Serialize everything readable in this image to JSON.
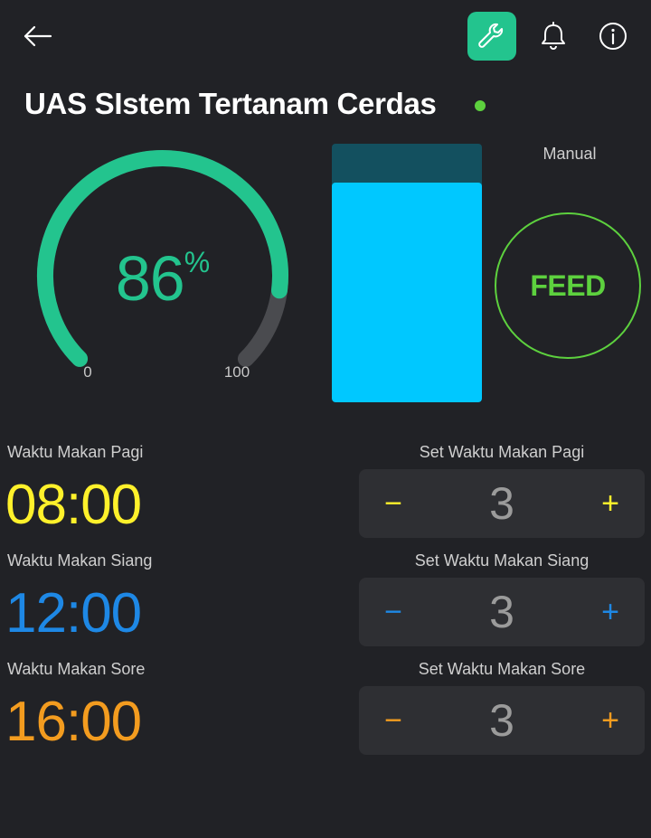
{
  "header": {
    "back_icon": "arrow-left-icon",
    "tool_icon": "wrench-icon",
    "bell_icon": "bell-icon",
    "info_icon": "info-icon",
    "accent": "#23c48e"
  },
  "title": "UAS SIstem Tertanam Cerdas",
  "status_color": "#5dd13e",
  "gauge": {
    "value": "86",
    "unit": "%",
    "min": "0",
    "max": "100",
    "fraction": 0.86,
    "color": "#23c48e",
    "track_color": "#4a4b4f"
  },
  "level": {
    "fraction": 0.85,
    "fill_color": "#00c8ff"
  },
  "manual": {
    "label": "Manual",
    "feed_label": "FEED"
  },
  "schedule": [
    {
      "label": "Waktu Makan Pagi",
      "time": "08:00",
      "color": "#fff12b",
      "set_label": "Set Waktu Makan Pagi",
      "value": "3",
      "minus": "−",
      "plus": "+"
    },
    {
      "label": "Waktu Makan Siang",
      "time": "12:00",
      "color": "#1e88e5",
      "set_label": "Set Waktu Makan Siang",
      "value": "3",
      "minus": "−",
      "plus": "+"
    },
    {
      "label": "Waktu Makan Sore",
      "time": "16:00",
      "color": "#f39c1f",
      "set_label": "Set Waktu Makan Sore",
      "value": "3",
      "minus": "−",
      "plus": "+"
    }
  ]
}
